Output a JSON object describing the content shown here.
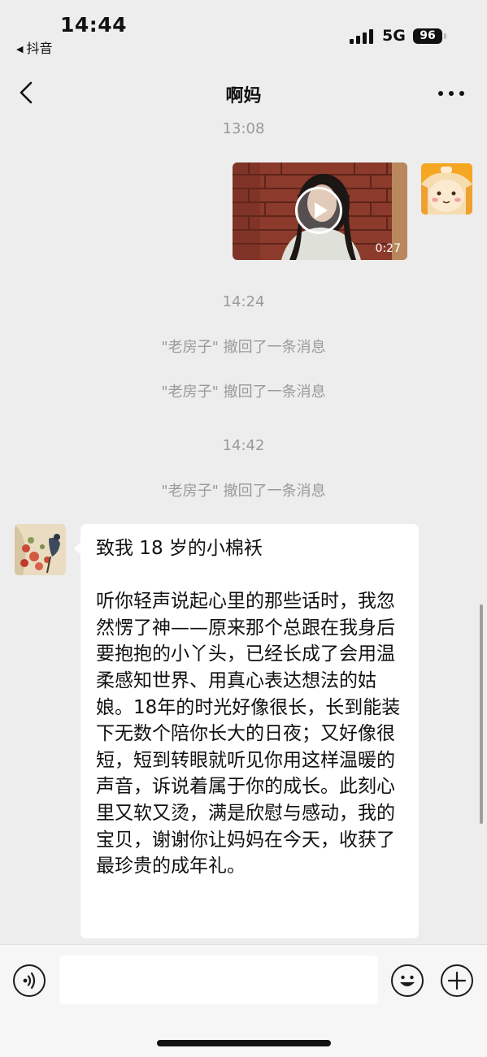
{
  "status_bar": {
    "time": "14:44",
    "back_app": "抖音",
    "network": "5G",
    "battery": "96"
  },
  "nav": {
    "title": "啊妈"
  },
  "chat": {
    "timestamps": [
      "13:08",
      "14:24",
      "14:42"
    ],
    "video_message": {
      "duration": "0:27"
    },
    "system_messages": [
      "\"老房子\" 撤回了一条消息",
      "\"老房子\" 撤回了一条消息",
      "\"老房子\" 撤回了一条消息"
    ],
    "letter": {
      "title": "致我 18 岁的小棉袄",
      "body": "听你轻声说起心里的那些话时，我忽然愣了神——原来那个总跟在我身后要抱抱的小丫头，已经长成了会用温柔感知世界、用真心表达想法的姑娘。18年的时光好像很长，长到能装下无数个陪你长大的日夜；又好像很短，短到转眼就听见你用这样温暖的声音，诉说着属于你的成长。此刻心里又软又烫，满是欣慰与感动，我的宝贝，谢谢你让妈妈在今天，收获了最珍贵的成年礼。"
    }
  },
  "input_bar": {
    "placeholder": ""
  },
  "colors": {
    "background": "#ededed",
    "bubble": "#ffffff",
    "system_text": "#9a9a9a",
    "input_bar": "#f6f6f6"
  }
}
